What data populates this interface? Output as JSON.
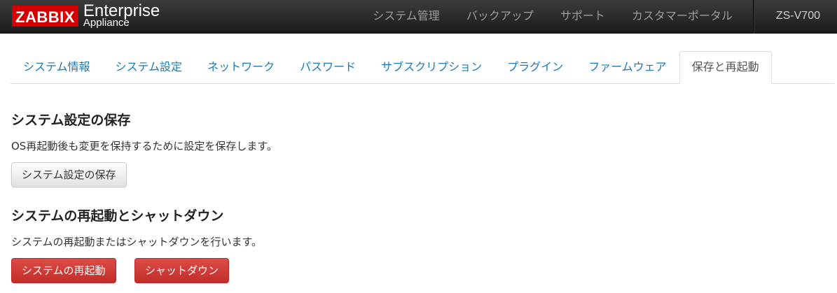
{
  "header": {
    "logo_text": "ZABBIX",
    "brand_line1": "Enterprise",
    "brand_line2": "Appliance",
    "menu": [
      "システム管理",
      "バックアップ",
      "サポート",
      "カスタマーポータル"
    ],
    "host": "ZS-V700"
  },
  "tabs": [
    {
      "label": "システム情報",
      "active": false
    },
    {
      "label": "システム設定",
      "active": false
    },
    {
      "label": "ネットワーク",
      "active": false
    },
    {
      "label": "パスワード",
      "active": false
    },
    {
      "label": "サブスクリプション",
      "active": false
    },
    {
      "label": "プラグイン",
      "active": false
    },
    {
      "label": "ファームウェア",
      "active": false
    },
    {
      "label": "保存と再起動",
      "active": true
    }
  ],
  "save_section": {
    "title": "システム設定の保存",
    "description": "OS再起動後も変更を保持するために設定を保存します。",
    "button": "システム設定の保存"
  },
  "reboot_section": {
    "title": "システムの再起動とシャットダウン",
    "description": "システムの再起動またはシャットダウンを行います。",
    "reboot_button": "システムの再起動",
    "shutdown_button": "シャットダウン"
  },
  "colors": {
    "navbar": "#222222",
    "logo_red": "#d40000",
    "link_blue": "#1a7ab8",
    "danger": "#d9534f"
  }
}
